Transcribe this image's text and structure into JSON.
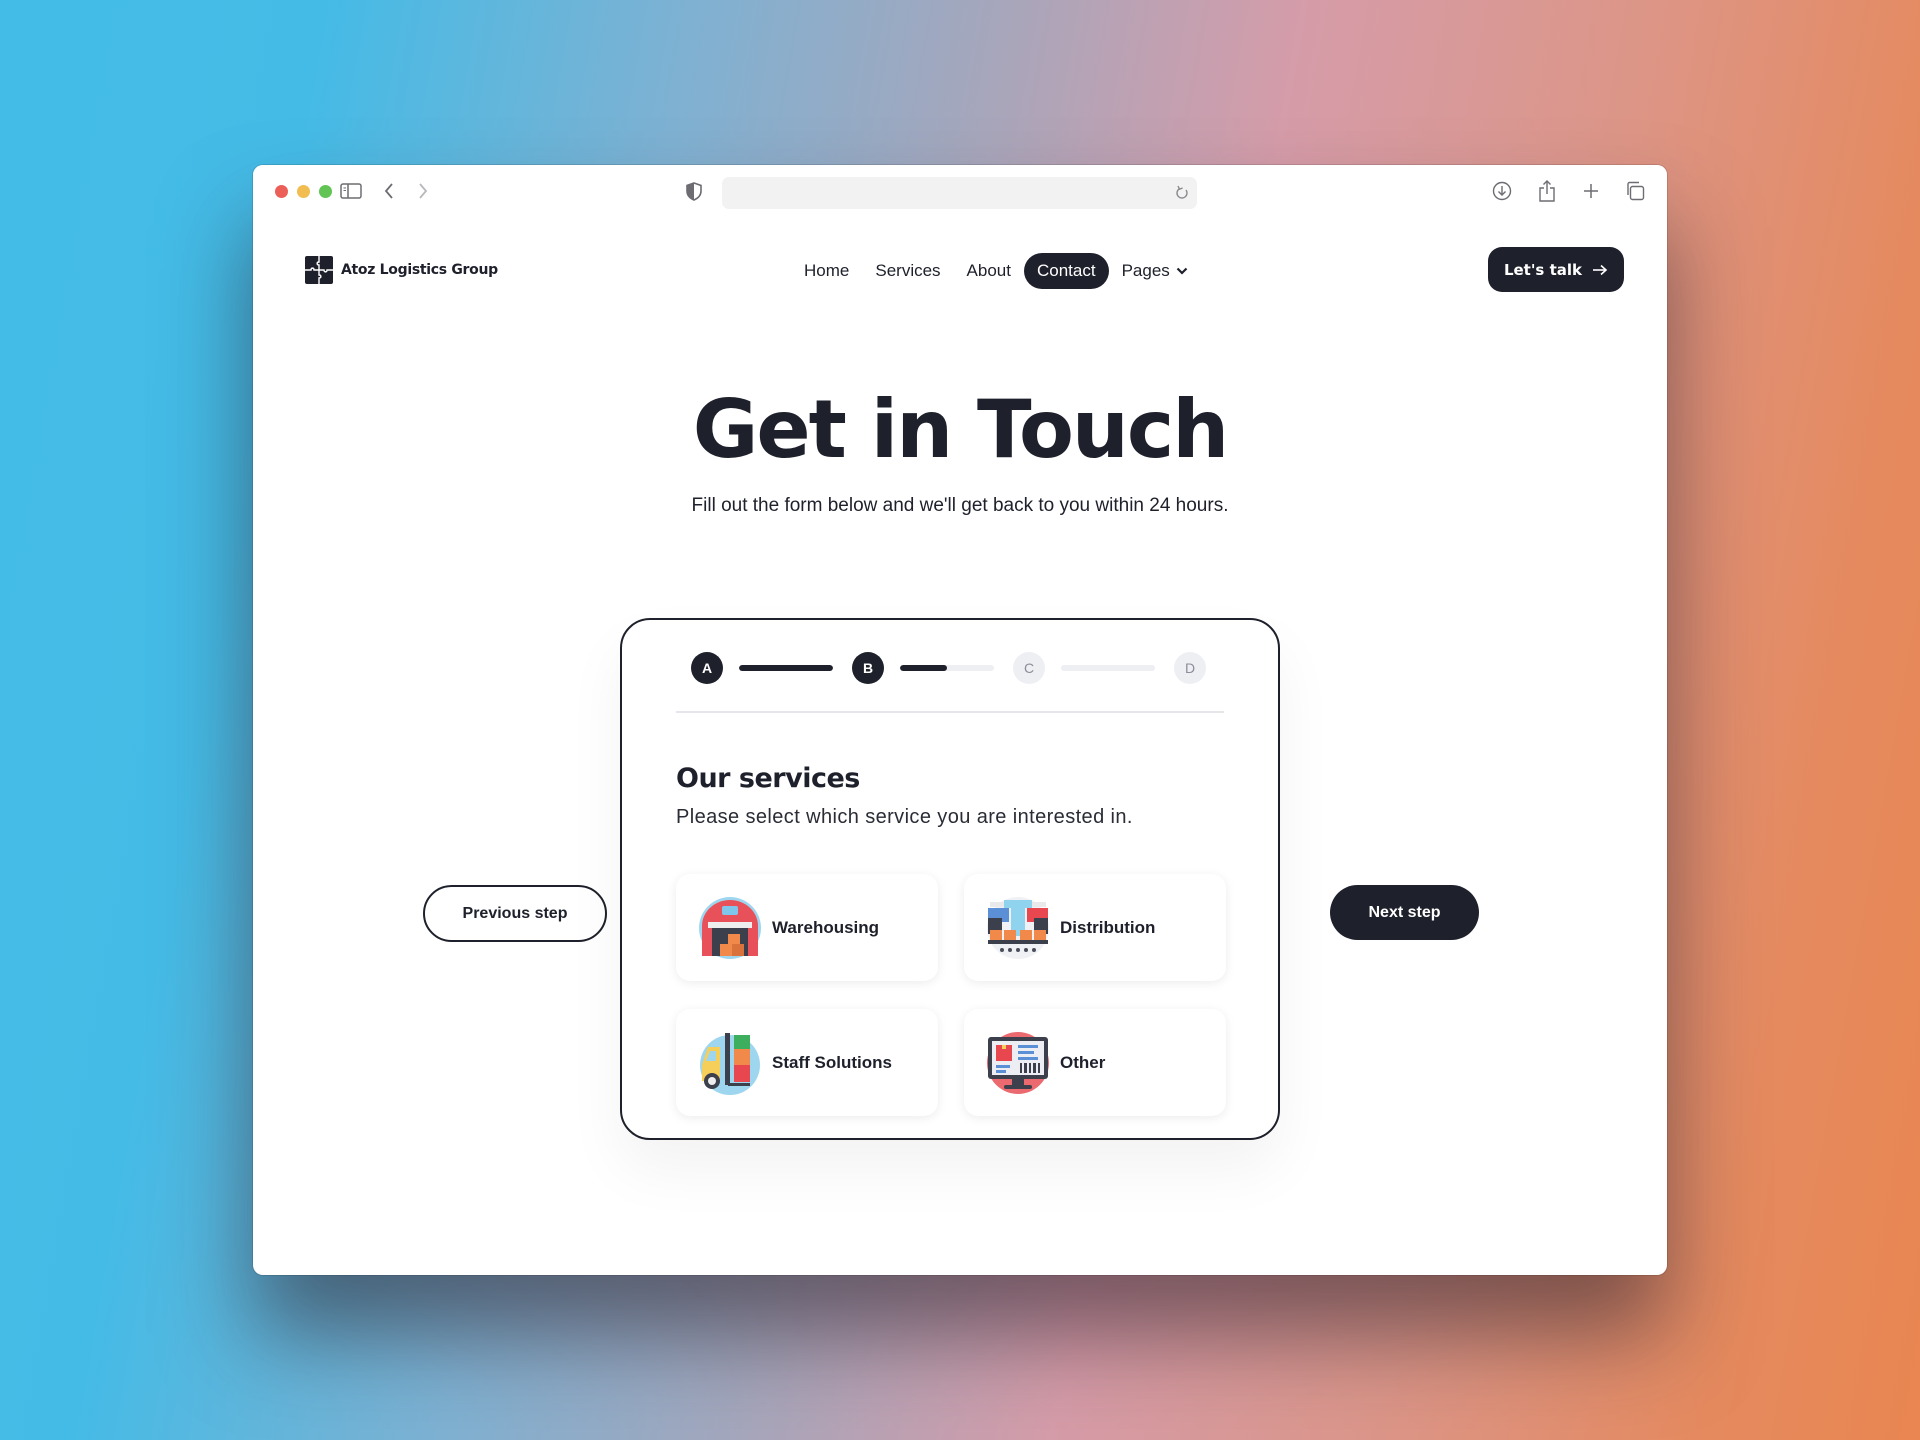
{
  "browser": {
    "url": "",
    "icons": [
      "sidebar-icon",
      "back-icon",
      "forward-icon",
      "privacy-shield-icon",
      "reload-icon",
      "download-icon",
      "share-icon",
      "new-tab-icon",
      "tab-overview-icon"
    ]
  },
  "nav": {
    "brand": "Atoz Logistics Group",
    "items": [
      {
        "label": "Home",
        "active": false
      },
      {
        "label": "Services",
        "active": false
      },
      {
        "label": "About",
        "active": false
      },
      {
        "label": "Contact",
        "active": true
      },
      {
        "label": "Pages",
        "active": false,
        "dropdown": true
      }
    ],
    "cta_label": "Let's talk"
  },
  "hero": {
    "title": "Get in Touch",
    "subtitle": "Fill out the form below and we'll get back to you within 24 hours."
  },
  "form": {
    "steps": [
      {
        "label": "A",
        "state": "done"
      },
      {
        "label": "B",
        "state": "current"
      },
      {
        "label": "C",
        "state": "todo"
      },
      {
        "label": "D",
        "state": "todo"
      }
    ],
    "step_progress": [
      1.0,
      0.5,
      0.0
    ],
    "section_title": "Our services",
    "section_subtitle": "Please select which service you are interested in.",
    "options": [
      {
        "label": "Warehousing",
        "icon": "warehouse-icon"
      },
      {
        "label": "Distribution",
        "icon": "distribution-conveyor-icon"
      },
      {
        "label": "Staff Solutions",
        "icon": "forklift-icon"
      },
      {
        "label": "Other",
        "icon": "monitor-icon"
      }
    ]
  },
  "buttons": {
    "previous": "Previous step",
    "next": "Next step"
  },
  "colors": {
    "primary": "#1e202b",
    "muted": "#eeeff3",
    "background_left": "#43bde8",
    "background_right": "#e98651"
  }
}
